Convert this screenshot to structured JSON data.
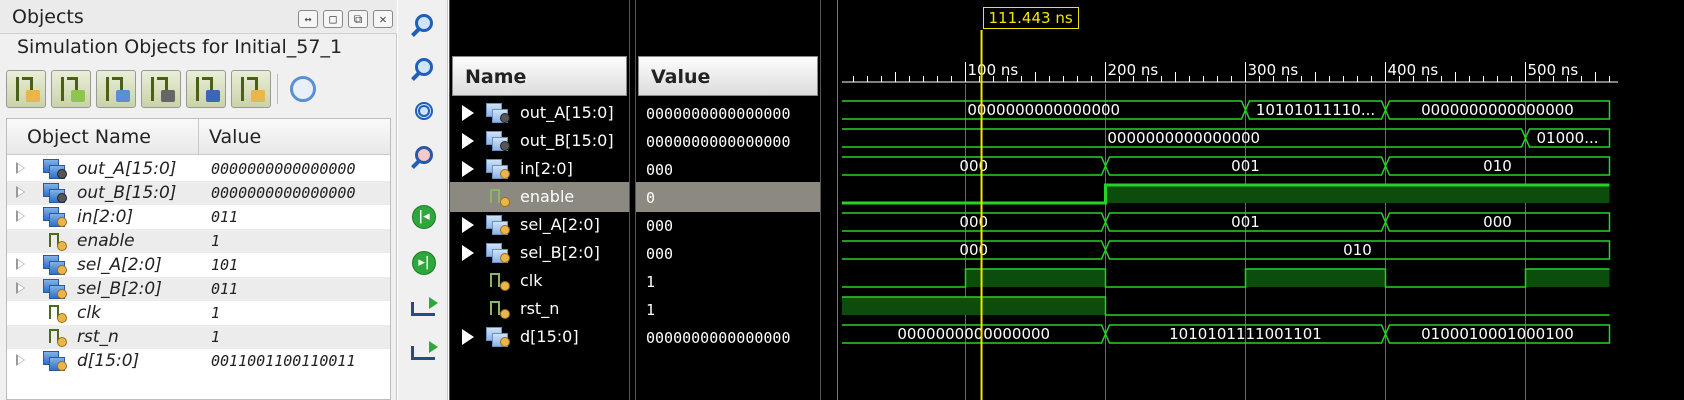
{
  "objects_panel": {
    "title": "Objects",
    "window_buttons": [
      "↔",
      "□",
      "⧉",
      "✕"
    ],
    "subtitle": "Simulation Objects for Initial_57_1",
    "toolbar_icons": [
      "input-port-filter-icon",
      "output-port-filter-icon",
      "inout-port-filter-icon",
      "internal-signal-filter-icon",
      "constant-filter-icon",
      "variable-filter-icon",
      "settings-gear-icon"
    ],
    "columns": {
      "name": "Object Name",
      "value": "Value"
    },
    "rows": [
      {
        "name": "out_A[15:0]",
        "value": "0000000000000000",
        "type": "bus",
        "port": "out"
      },
      {
        "name": "out_B[15:0]",
        "value": "0000000000000000",
        "type": "bus",
        "port": "out"
      },
      {
        "name": "in[2:0]",
        "value": "011",
        "type": "bus",
        "port": "in"
      },
      {
        "name": "enable",
        "value": "1",
        "type": "bit",
        "port": "in"
      },
      {
        "name": "sel_A[2:0]",
        "value": "101",
        "type": "bus",
        "port": "in"
      },
      {
        "name": "sel_B[2:0]",
        "value": "011",
        "type": "bus",
        "port": "in"
      },
      {
        "name": "clk",
        "value": "1",
        "type": "bit",
        "port": "in"
      },
      {
        "name": "rst_n",
        "value": "1",
        "type": "bit",
        "port": "in"
      },
      {
        "name": "d[15:0]",
        "value": "0011001100110011",
        "type": "bus",
        "port": "in"
      }
    ]
  },
  "tool_strip": [
    "zoom-in-icon",
    "zoom-out-icon",
    "zoom-fit-icon",
    "zoom-to-cursor-icon",
    "go-to-start-icon",
    "go-to-end-icon",
    "previous-transition-icon",
    "next-transition-icon"
  ],
  "wave_window": {
    "name_header": "Name",
    "value_header": "Value",
    "cursor_time": "111.443 ns",
    "time_ticks": [
      "100 ns",
      "200 ns",
      "300 ns",
      "400 ns",
      "500 ns"
    ],
    "signals": [
      {
        "name": "out_A[15:0]",
        "value": "0000000000000000",
        "type": "bus",
        "port": "out"
      },
      {
        "name": "out_B[15:0]",
        "value": "0000000000000000",
        "type": "bus",
        "port": "out"
      },
      {
        "name": "in[2:0]",
        "value": "000",
        "type": "bus",
        "port": "in"
      },
      {
        "name": "enable",
        "value": "0",
        "type": "bit",
        "port": "in",
        "selected": true
      },
      {
        "name": "sel_A[2:0]",
        "value": "000",
        "type": "bus",
        "port": "in"
      },
      {
        "name": "sel_B[2:0]",
        "value": "000",
        "type": "bus",
        "port": "in"
      },
      {
        "name": "clk",
        "value": "1",
        "type": "bit",
        "port": "in"
      },
      {
        "name": "rst_n",
        "value": "1",
        "type": "bit",
        "port": "in"
      },
      {
        "name": "d[15:0]",
        "value": "0000000000000000",
        "type": "bus",
        "port": "in"
      }
    ],
    "waveforms": {
      "out_A": {
        "segments": [
          {
            "from_ns": 5,
            "to_ns": 300,
            "label": "0000000000000000"
          },
          {
            "from_ns": 300,
            "to_ns": 400,
            "label": "10101011110..."
          },
          {
            "from_ns": 400,
            "to_ns": 560,
            "label": "0000000000000000"
          }
        ]
      },
      "out_B": {
        "segments": [
          {
            "from_ns": 5,
            "to_ns": 500,
            "label": "0000000000000000"
          },
          {
            "from_ns": 500,
            "to_ns": 560,
            "label": "01000..."
          }
        ]
      },
      "in": {
        "segments": [
          {
            "from_ns": 5,
            "to_ns": 200,
            "label": "000"
          },
          {
            "from_ns": 200,
            "to_ns": 400,
            "label": "001"
          },
          {
            "from_ns": 400,
            "to_ns": 560,
            "label": "010"
          }
        ]
      },
      "enable": {
        "levels": [
          {
            "from_ns": 5,
            "to_ns": 200,
            "level": 0
          },
          {
            "from_ns": 200,
            "to_ns": 560,
            "level": 1
          }
        ]
      },
      "sel_A": {
        "segments": [
          {
            "from_ns": 5,
            "to_ns": 200,
            "label": "000"
          },
          {
            "from_ns": 200,
            "to_ns": 400,
            "label": "001"
          },
          {
            "from_ns": 400,
            "to_ns": 560,
            "label": "000"
          }
        ]
      },
      "sel_B": {
        "segments": [
          {
            "from_ns": 5,
            "to_ns": 200,
            "label": "000"
          },
          {
            "from_ns": 200,
            "to_ns": 560,
            "label": "010"
          }
        ]
      },
      "clk": {
        "levels": [
          {
            "from_ns": 5,
            "to_ns": 100,
            "level": 0
          },
          {
            "from_ns": 100,
            "to_ns": 200,
            "level": 1
          },
          {
            "from_ns": 200,
            "to_ns": 300,
            "level": 0
          },
          {
            "from_ns": 300,
            "to_ns": 400,
            "level": 1
          },
          {
            "from_ns": 400,
            "to_ns": 500,
            "level": 0
          },
          {
            "from_ns": 500,
            "to_ns": 560,
            "level": 1
          }
        ]
      },
      "rst_n": {
        "levels": [
          {
            "from_ns": 5,
            "to_ns": 200,
            "level": 1
          },
          {
            "from_ns": 200,
            "to_ns": 560,
            "level": 0
          }
        ]
      },
      "d": {
        "segments": [
          {
            "from_ns": 5,
            "to_ns": 200,
            "label": "0000000000000000"
          },
          {
            "from_ns": 200,
            "to_ns": 400,
            "label": "1010101111001101"
          },
          {
            "from_ns": 400,
            "to_ns": 560,
            "label": "0100010001000100"
          }
        ]
      }
    },
    "cursor_ns": 111.443,
    "colors": {
      "wave": "#27d227",
      "wave_fill": "#0c4d0c",
      "cursor": "#f2e600",
      "grid": "#6a6a6a",
      "error_x": "#33ff33"
    }
  }
}
